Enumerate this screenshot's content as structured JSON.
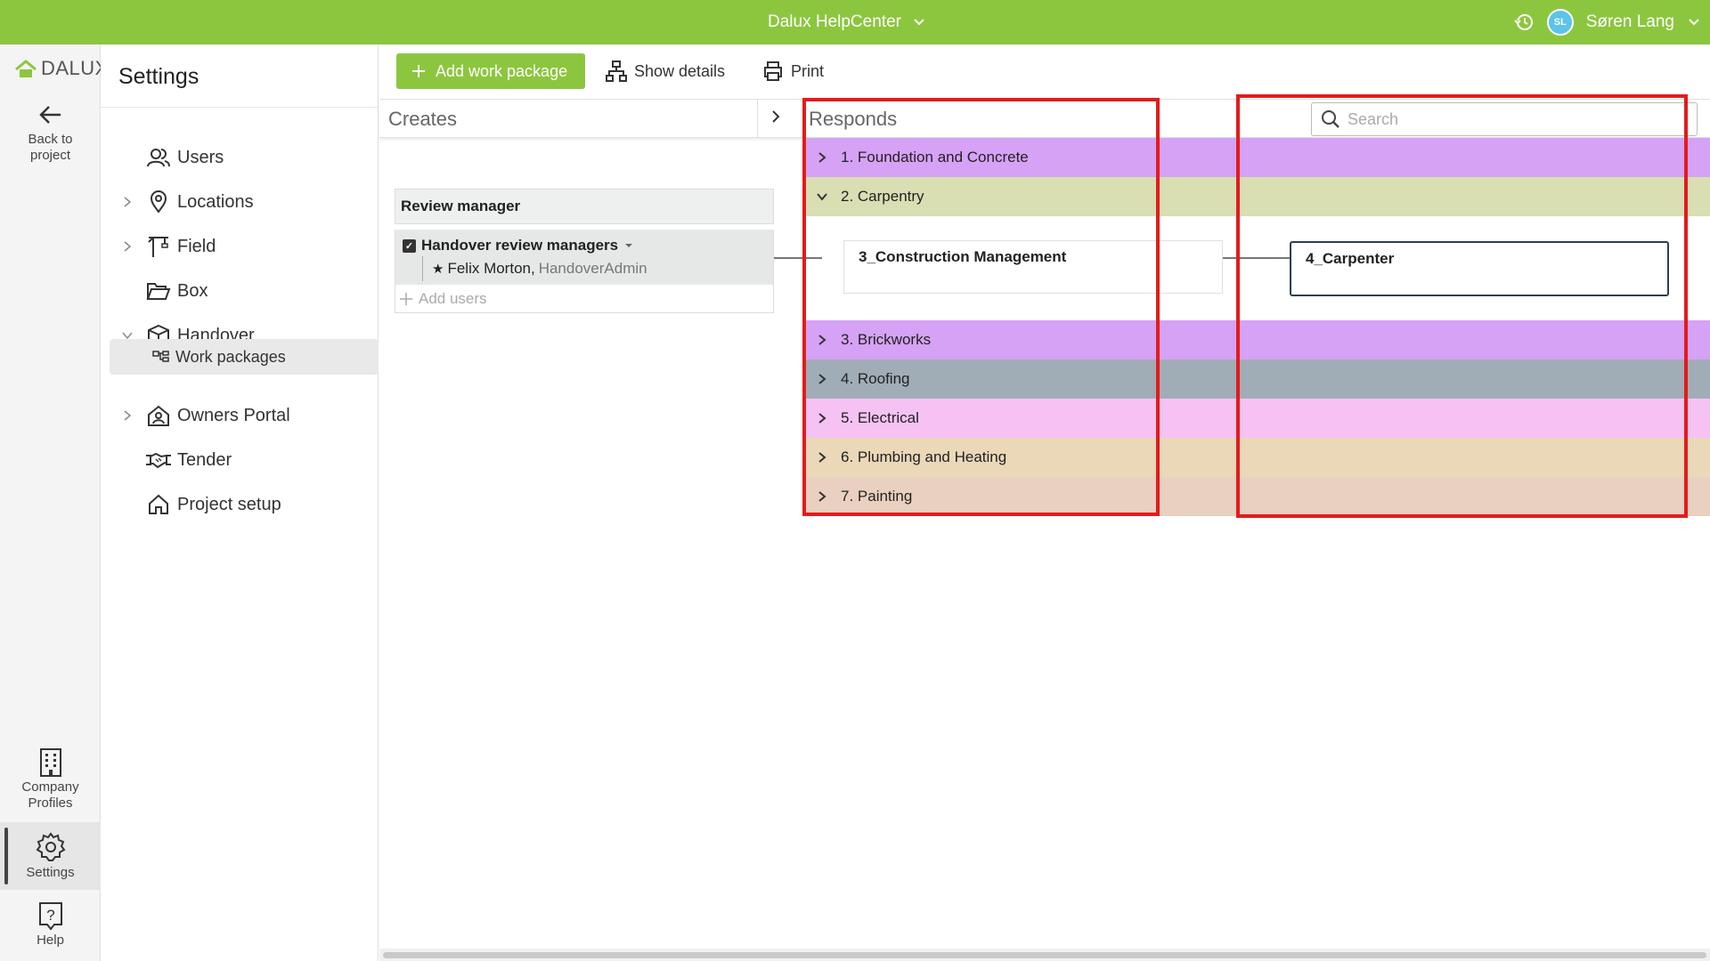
{
  "topbar": {
    "app_name": "Dalux HelpCenter",
    "user_initials": "SL",
    "user_name": "Søren Lang"
  },
  "rail": {
    "logo_text": "DALUX",
    "back": "Back to project",
    "company_profiles": "Company Profiles",
    "settings": "Settings",
    "help": "Help"
  },
  "nav": {
    "title": "Settings",
    "items": [
      {
        "label": "Users"
      },
      {
        "label": "Locations"
      },
      {
        "label": "Field"
      },
      {
        "label": "Box"
      },
      {
        "label": "Handover"
      },
      {
        "label": "Work packages"
      },
      {
        "label": "Owners Portal"
      },
      {
        "label": "Tender"
      },
      {
        "label": "Project setup"
      }
    ]
  },
  "toolbar": {
    "add_label": "Add work package",
    "details_label": "Show details",
    "print_label": "Print"
  },
  "columns": {
    "creates": "Creates",
    "responds": "Responds",
    "search_placeholder": "Search"
  },
  "review": {
    "title": "Review manager",
    "group_name": "Handover review managers",
    "member_name": "Felix Morton,",
    "member_role": "HandoverAdmin",
    "add_users": "Add users"
  },
  "categories": [
    {
      "label": "1. Foundation and Concrete",
      "color": "#d6a2f5"
    },
    {
      "label": "2. Carpentry",
      "color": "#d9dfb3"
    },
    {
      "label": "3. Brickworks",
      "color": "#d6a2f5"
    },
    {
      "label": "4. Roofing",
      "color": "#a1adb6"
    },
    {
      "label": "5. Electrical",
      "color": "#f5c2f3"
    },
    {
      "label": "6. Plumbing and Heating",
      "color": "#ead8b9"
    },
    {
      "label": "7. Painting",
      "color": "#ead0c0"
    }
  ],
  "nodes": {
    "construction": "3_Construction Management",
    "carpenter": "4_Carpenter"
  },
  "colors": {
    "brand_green": "#8cc63f",
    "highlight_red": "#e31b1b"
  }
}
